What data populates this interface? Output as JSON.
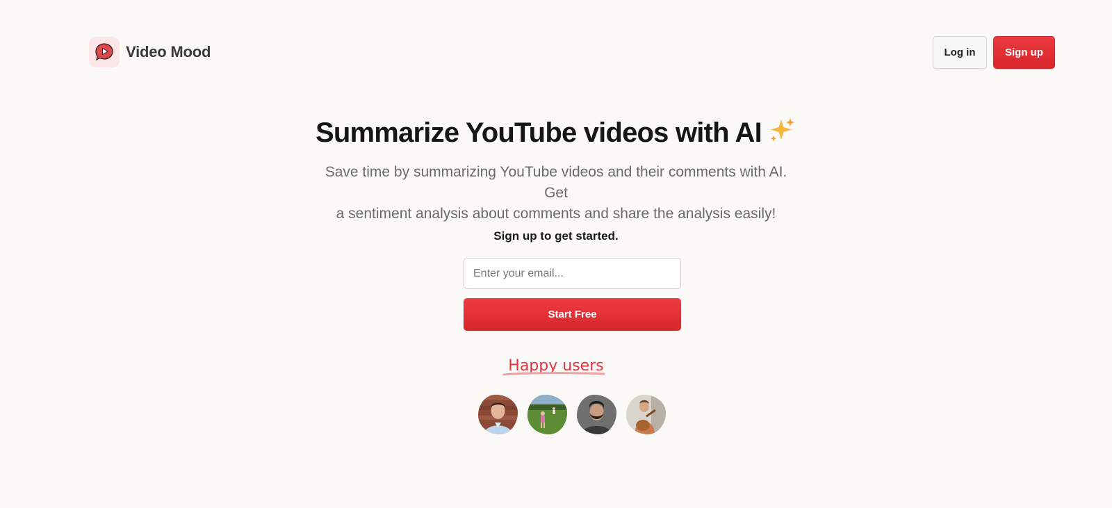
{
  "brand": {
    "name": "Video Mood",
    "logo_icon": "play-chat-bubble-icon",
    "accent": "#e5343b"
  },
  "nav": {
    "login_label": "Log in",
    "signup_label": "Sign up"
  },
  "hero": {
    "title": "Summarize YouTube videos with AI",
    "sparkle_icon": "sparkles-icon",
    "subtitle_line1": "Save time by summarizing YouTube videos and their comments with AI. Get",
    "subtitle_line2": "a sentiment analysis about comments and share the analysis easily!"
  },
  "signup": {
    "label": "Sign up to get started.",
    "email_placeholder": "Enter your email...",
    "button_label": "Start Free"
  },
  "social_proof": {
    "title": "Happy users",
    "avatars": [
      "user-avatar-1",
      "user-avatar-2",
      "user-avatar-3",
      "user-avatar-4"
    ]
  }
}
